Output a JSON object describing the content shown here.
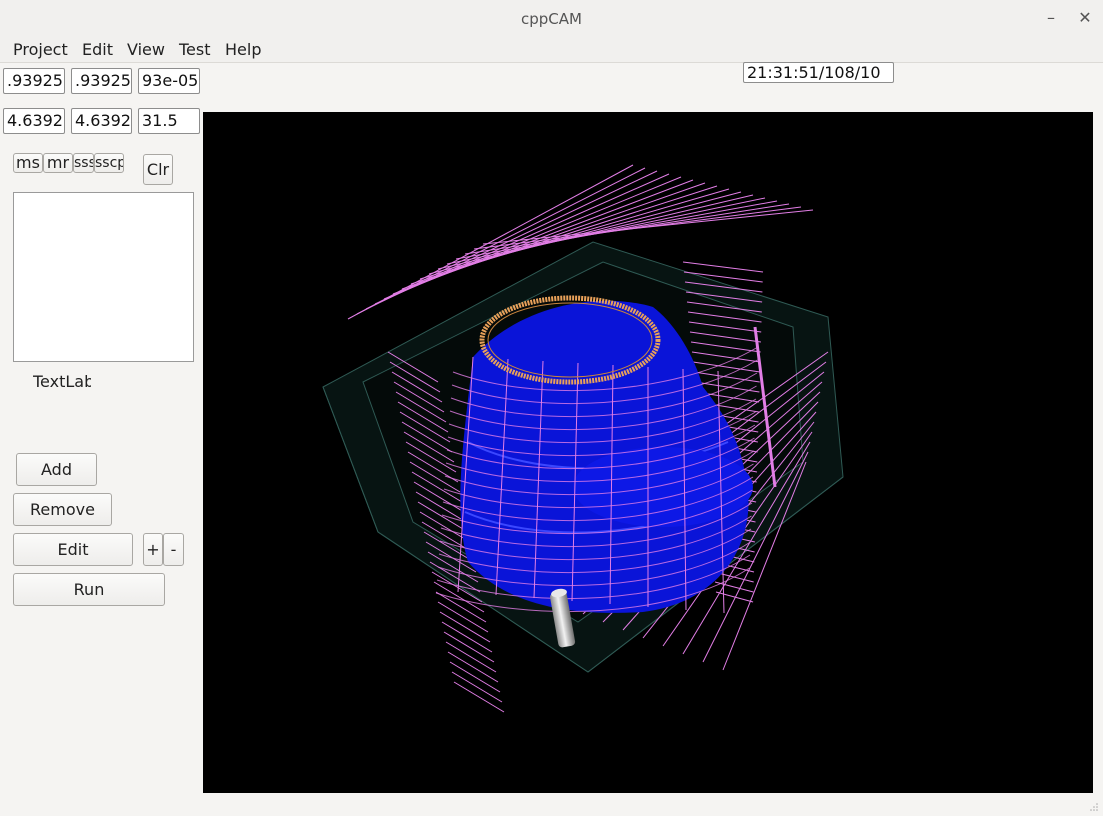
{
  "window": {
    "title": "cppCAM",
    "minimize_glyph": "–",
    "close_glyph": "✕"
  },
  "menu": [
    {
      "label": "Project"
    },
    {
      "label": "Edit"
    },
    {
      "label": "View"
    },
    {
      "label": "Test"
    },
    {
      "label": "Help"
    }
  ],
  "coords": {
    "row1": [
      ".93925",
      ".93925",
      "93e-05"
    ],
    "row2": [
      "4.6392",
      "4.6392",
      "31.5"
    ]
  },
  "timestamp": "21:31:51/108/10",
  "small_buttons": [
    "ms",
    "mr",
    "sss",
    "sscp"
  ],
  "clear_button": "Clr",
  "text_label": "TextLab",
  "buttons": {
    "add": "Add",
    "remove": "Remove",
    "edit": "Edit",
    "plus": "+",
    "minus": "-",
    "run": "Run"
  },
  "colors": {
    "viewport_bg": "#000000",
    "model_fill": "#0a14d8",
    "toolpath": "#e27ee6",
    "ring": "#e9a15a",
    "stock_edges": "#2f5a54"
  },
  "icons": {
    "tool": "end-mill-tool-icon",
    "resize": "resize-grip-icon"
  }
}
